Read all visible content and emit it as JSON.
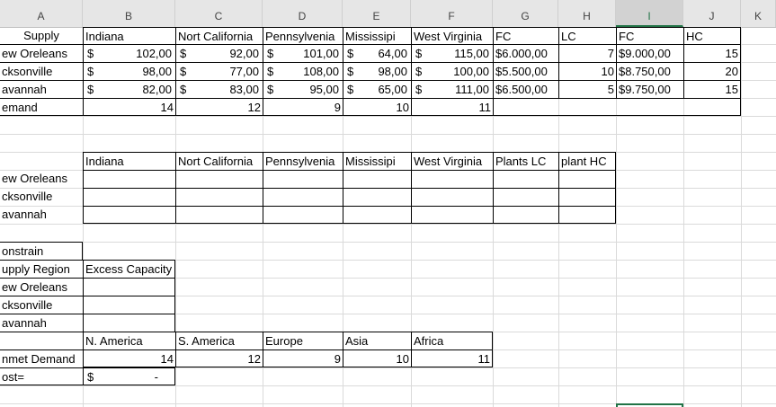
{
  "columns": [
    "A",
    "B",
    "C",
    "D",
    "E",
    "F",
    "G",
    "H",
    "I",
    "J",
    "K"
  ],
  "selected_column": "I",
  "table1": {
    "header": {
      "a": "Supply",
      "b": "Indiana",
      "c": "Nort California",
      "d": "Pennsylvenia",
      "e": "Mississipi",
      "f": "West Virginia",
      "g": "FC",
      "h": "LC",
      "i": "FC",
      "j": "HC"
    },
    "rows": [
      {
        "name": "ew Oreleans",
        "b": "102,00",
        "c": "92,00",
        "d": "101,00",
        "e": "64,00",
        "f": "115,00",
        "g": "$6.000,00",
        "h": "7",
        "i": "$9.000,00",
        "j": "15"
      },
      {
        "name": "cksonville",
        "b": "98,00",
        "c": "77,00",
        "d": "108,00",
        "e": "98,00",
        "f": "100,00",
        "g": "$5.500,00",
        "h": "10",
        "i": "$8.750,00",
        "j": "20"
      },
      {
        "name": "avannah",
        "b": "82,00",
        "c": "83,00",
        "d": "95,00",
        "e": "65,00",
        "f": "111,00",
        "g": "$6.500,00",
        "h": "5",
        "i": "$9.750,00",
        "j": "15"
      }
    ],
    "demand": {
      "name": "emand",
      "b": "14",
      "c": "12",
      "d": "9",
      "e": "10",
      "f": "11"
    },
    "currency": "$"
  },
  "table2": {
    "header": {
      "b": "Indiana",
      "c": "Nort California",
      "d": "Pennsylvenia",
      "e": "Mississipi",
      "f": "West Virginia",
      "g": "Plants LC",
      "h": "plant HC"
    },
    "rows": [
      "ew Oreleans",
      "cksonville",
      "avannah"
    ]
  },
  "table3": {
    "title": "onstrain",
    "header_a": "upply Region",
    "header_b": "Excess Capacity",
    "rows": [
      "ew Oreleans",
      "cksonville",
      "avannah"
    ]
  },
  "table4": {
    "header": {
      "b": "N. America",
      "c": "S. America",
      "d": "Europe",
      "e": "Asia",
      "f": "Africa"
    },
    "unmet": {
      "name": "nmet Demand",
      "b": "14",
      "c": "12",
      "d": "9",
      "e": "10",
      "f": "11"
    },
    "cost": {
      "name": "ost=",
      "symbol": "$",
      "value": "-"
    }
  }
}
